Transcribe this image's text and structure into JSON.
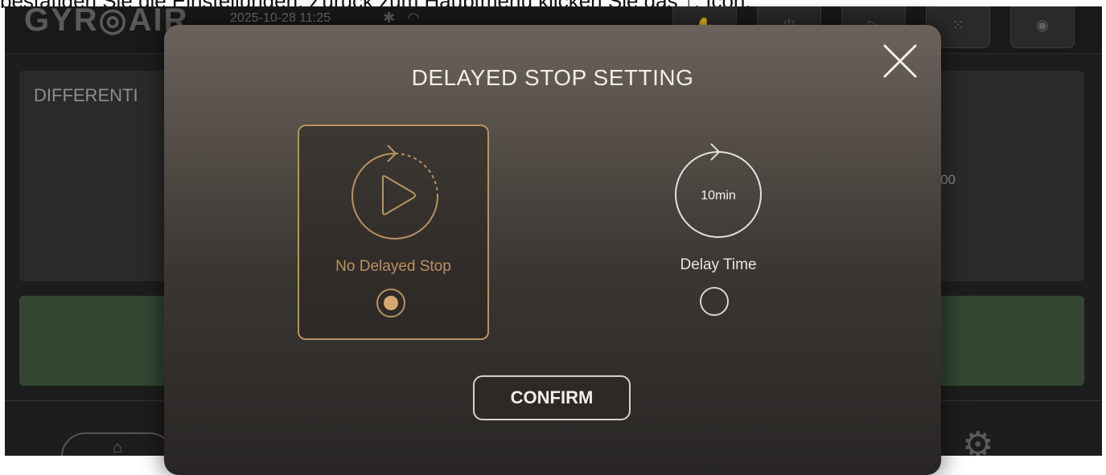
{
  "caption": "bestätigen Sie die Einstellungen. Zurück zum Hauptmenü klicken Sie das ↑. Icon.",
  "app": {
    "logo": "GYR◎AIR",
    "datetime": "2025-10-28 11:25",
    "status_icons": [
      "bluetooth-icon",
      "wifi-icon"
    ],
    "top_buttons": [
      "hand-icon",
      "power-icon",
      "play-icon",
      "grid-icon",
      "camera-icon"
    ]
  },
  "background": {
    "panel_title": "DIFFERENTI",
    "panel_value": "00"
  },
  "modal": {
    "title": "DELAYED STOP SETTING",
    "options": [
      {
        "label": "No Delayed Stop",
        "icon": "play-circle-icon",
        "selected": true
      },
      {
        "label": "Delay Time",
        "icon_text": "10min",
        "icon": "timer-circle-icon",
        "selected": false
      }
    ],
    "confirm_label": "CONFIRM"
  },
  "colors": {
    "accent": "#b8935f",
    "radio_fill": "#d4a86f",
    "text_light": "#f1ede8"
  }
}
